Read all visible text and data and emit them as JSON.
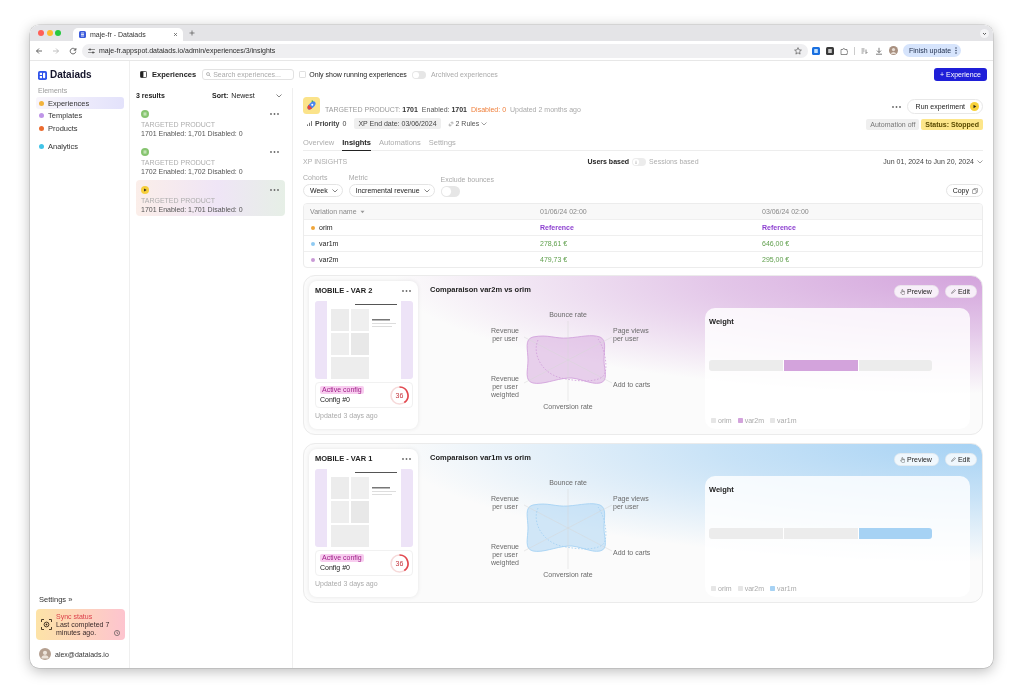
{
  "browser": {
    "tab_title": "maje-fr - Dataiads",
    "url": "maje-fr.appspot.dataiads.io/admin/experiences/3/insights",
    "update_button": "Finish update"
  },
  "sidebar": {
    "logo": "Dataiads",
    "sections": [
      {
        "label": "Elements",
        "items": [
          {
            "label": "Experiences",
            "color": "#f2b33d",
            "selected": true
          },
          {
            "label": "Templates",
            "color": "#bf95e8",
            "selected": false
          },
          {
            "label": "Products",
            "color": "#eb6b2f",
            "selected": false
          }
        ]
      },
      {
        "items": [
          {
            "label": "Analytics",
            "color": "#41c4e8",
            "selected": false
          }
        ]
      }
    ],
    "settings_link": "Settings »",
    "sync": {
      "title": "Sync status",
      "message": "Last completed 7 minutes ago."
    },
    "user_email": "alex@dataiads.io"
  },
  "topbar": {
    "title": "Experiences",
    "search": {
      "placeholder": "Search experiences..."
    },
    "running_filter": {
      "label": "Only show running experiences",
      "checked": false
    },
    "archived_toggle": {
      "label": "Archived experiences",
      "on": false
    },
    "new_button": "+ Experience"
  },
  "list": {
    "count": "3 results",
    "sort_label": "Sort:",
    "sort_value": "Newest",
    "items": [
      {
        "kind": "running",
        "category": "TARGETED PRODUCT",
        "summary": "1701 Enabled: 1,701 Disabled: 0",
        "selected": false
      },
      {
        "kind": "running",
        "category": "TARGETED PRODUCT",
        "summary": "1702 Enabled: 1,702 Disabled: 0",
        "selected": false
      },
      {
        "kind": "stopped",
        "category": "TARGETED PRODUCT",
        "summary": "1701 Enabled: 1,701 Disabled: 0",
        "selected": true
      }
    ]
  },
  "experience": {
    "meta": [
      {
        "kind": "label",
        "text": "TARGETED PRODUCT: **1701**"
      },
      {
        "kind": "plain",
        "text": "Enabled: **1701**"
      },
      {
        "kind": "warning",
        "text": "Disabled: 0"
      },
      {
        "kind": "muted",
        "text": "Updated 2 months ago"
      }
    ],
    "priority": {
      "label": "Priority",
      "value": "0"
    },
    "end_date": "XP End date: 03/06/2024",
    "rules": "2 Rules",
    "run_button": "Run experiment",
    "automation": "Automation off",
    "status": "Status: Stopped",
    "tabs": [
      {
        "label": "Overview",
        "selected": false
      },
      {
        "label": "Insights",
        "selected": true
      },
      {
        "label": "Automations",
        "selected": false
      },
      {
        "label": "Settings",
        "selected": false
      }
    ]
  },
  "insights": {
    "section_title": "XP INSIGHTS",
    "basis": [
      {
        "label": "Users based",
        "selected": true
      },
      {
        "label": "Sessions based",
        "selected": false
      }
    ],
    "date_range": "Jun 01, 2024 to Jun 20, 2024",
    "cohorts": {
      "label": "Cohorts",
      "value": "Week"
    },
    "metric": {
      "label": "Metric",
      "value": "Incremental revenue"
    },
    "exclude_bounces": {
      "label": "Exclude bounces",
      "on": false
    },
    "copy_button": "Copy",
    "table": {
      "columns": [
        "Variation name",
        "01/06/24 02:00",
        "03/06/24 02:00"
      ],
      "rows": [
        {
          "color": "#f0a63a",
          "cells": [
            {
              "kind": "name",
              "text": "orim"
            },
            {
              "kind": "reference",
              "text": "Reference"
            },
            {
              "kind": "reference",
              "text": "Reference"
            }
          ]
        },
        {
          "color": "#8fcaf2",
          "cells": [
            {
              "kind": "name",
              "text": "var1m"
            },
            {
              "kind": "value",
              "text": "278,61 €"
            },
            {
              "kind": "value",
              "text": "646,00 €"
            }
          ]
        },
        {
          "color": "#c99ad6",
          "cells": [
            {
              "kind": "name",
              "text": "var2m"
            },
            {
              "kind": "value",
              "text": "479,73 €"
            },
            {
              "kind": "value",
              "text": "295,00 €"
            }
          ]
        }
      ]
    }
  },
  "variations": [
    {
      "title": "MOBILE - VAR 2",
      "color": "#d3a3dc",
      "badge": "Active config",
      "config": "Config #0",
      "score": "36",
      "updated": "Updated 3 days ago",
      "comparison_title": "Comparaison var2m vs orim",
      "radar_axes": [
        "Bounce rate",
        "Revenue per user",
        "Page views per user",
        "Revenue per user weighted",
        "Add to carts",
        "Conversion rate"
      ],
      "preview_button": "Preview",
      "edit_button": "Edit",
      "weight": {
        "title": "Weight",
        "segments": [
          {
            "label": "orim",
            "selected": false
          },
          {
            "label": "var2m",
            "selected": true
          },
          {
            "label": "var1m",
            "selected": false
          }
        ]
      }
    },
    {
      "title": "MOBILE - VAR 1",
      "color": "#a6d2f4",
      "badge": "Active config",
      "config": "Config #0",
      "score": "36",
      "updated": "Updated 3 days ago",
      "comparison_title": "Comparaison var1m vs orim",
      "radar_axes": [
        "Bounce rate",
        "Revenue per user",
        "Page views per user",
        "Revenue per user weighted",
        "Add to carts",
        "Conversion rate"
      ],
      "preview_button": "Preview",
      "edit_button": "Edit",
      "weight": {
        "title": "Weight",
        "segments": [
          {
            "label": "orim",
            "selected": false
          },
          {
            "label": "var2m",
            "selected": false
          },
          {
            "label": "var1m",
            "selected": true
          }
        ]
      }
    }
  ]
}
